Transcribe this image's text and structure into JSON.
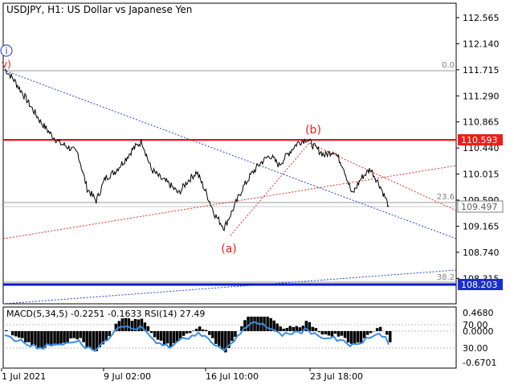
{
  "header": {
    "title": "USDJPY, H1:  US Dollar vs Japanese Yen"
  },
  "price_axis": {
    "ticks": [
      "112.565",
      "112.140",
      "111.715",
      "111.290",
      "110.865",
      "110.440",
      "110.015",
      "109.590",
      "109.165",
      "108.740",
      "108.315"
    ]
  },
  "markers": {
    "top_wave_label": "i",
    "start_label": "v)",
    "wave_a": "(a)",
    "wave_b": "(b)"
  },
  "fib": {
    "level_0": "0.0",
    "level_236": "23.6",
    "level_382": "38.2"
  },
  "price_badges": {
    "resistance": {
      "text": "110.593",
      "color": "#e8201a"
    },
    "current": {
      "text": "109.497",
      "color": "#808080"
    },
    "support": {
      "text": "108.203",
      "color": "#1a2fcc"
    }
  },
  "indicator": {
    "header": "MACD(5,34,5) -0.2251 -0.1633 RSI(14) 27.49",
    "ticks_right": [
      "0.4680",
      "70.00",
      "0.0000",
      "30.00",
      "-0.6701"
    ]
  },
  "time_axis": {
    "labels": [
      "1 Jul 2021",
      "9 Jul 02:00",
      "16 Jul 10:00",
      "23 Jul 18:00"
    ]
  },
  "colors": {
    "resistance_line": "#ff0000",
    "support_line": "#0018c8",
    "trend_blue": "#2a3fd6",
    "trend_red": "#e0302a",
    "rsi": "#3a8ee6"
  },
  "chart_data": {
    "type": "line",
    "ylim": [
      107.9,
      112.8
    ],
    "x": [
      "1 Jul 2021",
      "9 Jul 02:00",
      "16 Jul 10:00",
      "23 Jul 18:00"
    ],
    "series": [
      {
        "values": [
          111.73,
          111.55,
          111.32,
          111.08,
          110.85,
          110.67,
          110.52,
          110.45,
          110.35,
          109.78,
          109.58,
          109.95,
          110.05,
          110.22,
          110.42,
          110.55,
          110.1,
          109.95,
          109.85,
          109.7,
          109.9,
          110.05,
          109.72,
          109.35,
          109.14,
          109.45,
          109.78,
          110.02,
          110.2,
          110.32,
          110.16,
          110.35,
          110.52,
          110.59,
          110.44,
          110.32,
          110.4,
          110.15,
          109.68,
          109.95,
          110.1,
          109.84,
          109.5
        ]
      }
    ],
    "resistance": 110.593,
    "support": 108.203,
    "current": 109.497
  }
}
